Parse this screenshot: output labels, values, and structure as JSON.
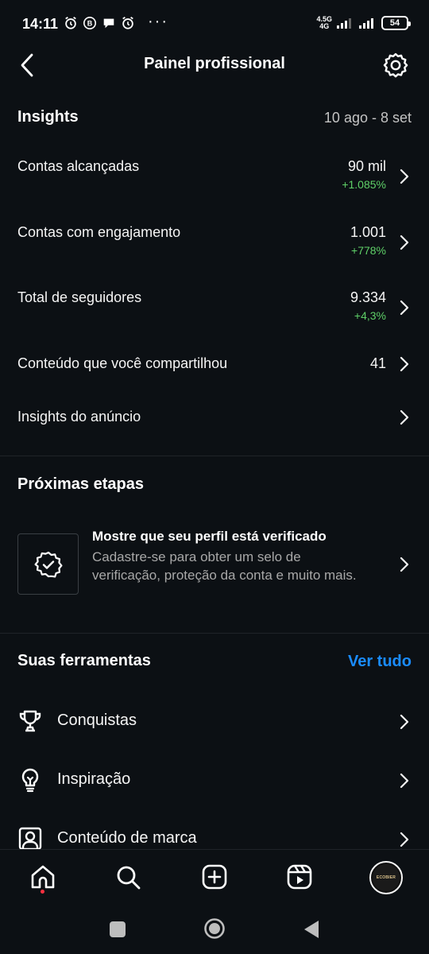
{
  "status": {
    "time": "14:11",
    "net_top": "4.5G",
    "net_bottom": "4G",
    "battery": "54",
    "dots": "···"
  },
  "header": {
    "title": "Painel profissional"
  },
  "insights": {
    "title": "Insights",
    "date_range": "10 ago - 8 set",
    "rows": [
      {
        "label": "Contas alcançadas",
        "value": "90 mil",
        "delta": "+1.085%"
      },
      {
        "label": "Contas com engajamento",
        "value": "1.001",
        "delta": "+778%"
      },
      {
        "label": "Total de seguidores",
        "value": "9.334",
        "delta": "+4,3%"
      },
      {
        "label": "Conteúdo que você compartilhou",
        "value": "41"
      },
      {
        "label": "Insights do anúncio"
      }
    ]
  },
  "next_steps": {
    "title": "Próximas etapas",
    "card_title": "Mostre que seu perfil está verificado",
    "card_desc": "Cadastre-se para obter um selo de verificação, proteção da conta e muito mais."
  },
  "tools": {
    "title": "Suas ferramentas",
    "see_all": "Ver tudo",
    "items": [
      {
        "label": "Conquistas",
        "icon": "trophy-icon"
      },
      {
        "label": "Inspiração",
        "icon": "lightbulb-icon"
      },
      {
        "label": "Conteúdo de marca",
        "icon": "branded-content-icon"
      }
    ]
  },
  "profile": {
    "avatar_text": "ECOBIER"
  },
  "colors": {
    "background": "#0c1014",
    "positive": "#5fd068",
    "link": "#1a8cff",
    "notification_dot": "#ff3040"
  }
}
